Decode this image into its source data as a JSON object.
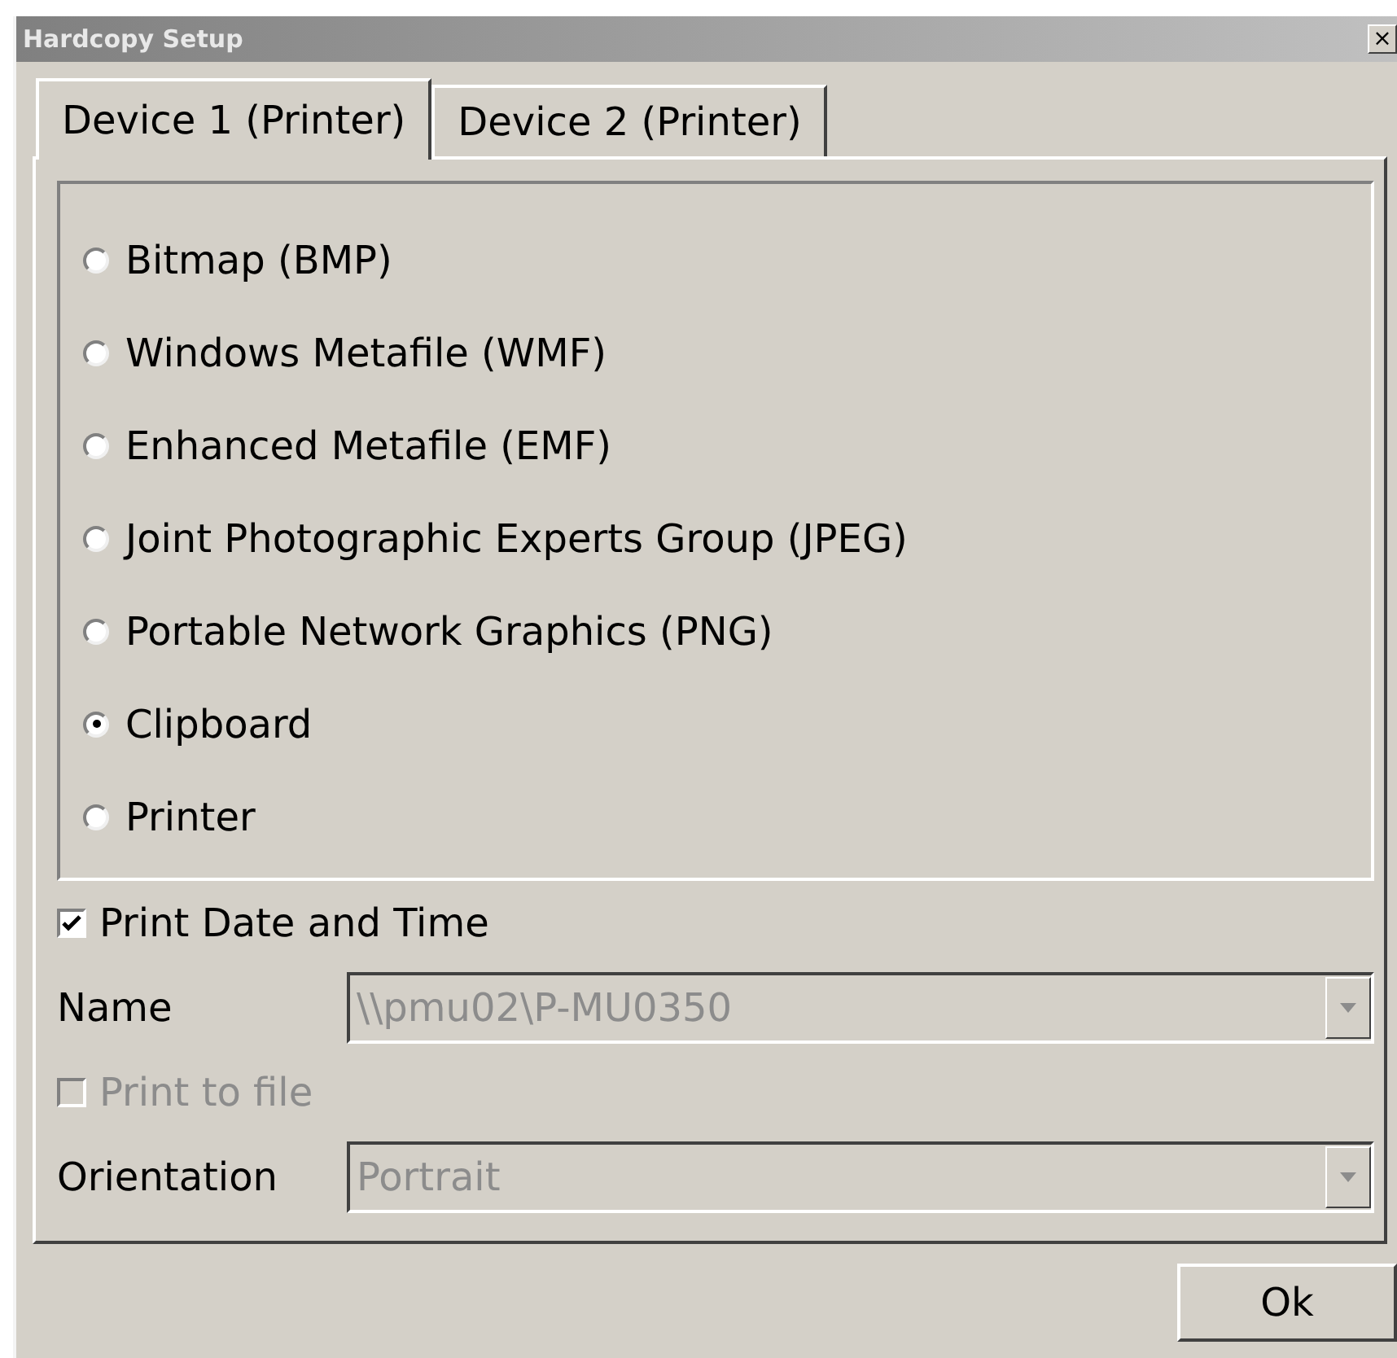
{
  "window": {
    "title": "Hardcopy Setup",
    "close": "×"
  },
  "tabs": [
    {
      "label": "Device 1 (Printer)",
      "selected": true
    },
    {
      "label": "Device 2 (Printer)",
      "selected": false
    }
  ],
  "formats": [
    {
      "label": "Bitmap (BMP)",
      "selected": false
    },
    {
      "label": "Windows Metafile (WMF)",
      "selected": false
    },
    {
      "label": "Enhanced Metafile (EMF)",
      "selected": false
    },
    {
      "label": "Joint Photographic Experts Group (JPEG)",
      "selected": false
    },
    {
      "label": "Portable Network Graphics (PNG)",
      "selected": false
    },
    {
      "label": "Clipboard",
      "selected": true
    },
    {
      "label": "Printer",
      "selected": false
    }
  ],
  "print_date_time": {
    "label": "Print Date and Time",
    "checked": true,
    "disabled": false
  },
  "name": {
    "label": "Name",
    "value": "\\\\pmu02\\P-MU0350",
    "disabled": true
  },
  "print_to_file": {
    "label": "Print to file",
    "checked": false,
    "disabled": true
  },
  "orientation": {
    "label": "Orientation",
    "value": "Portrait",
    "disabled": true
  },
  "buttons": [
    "Ok"
  ]
}
